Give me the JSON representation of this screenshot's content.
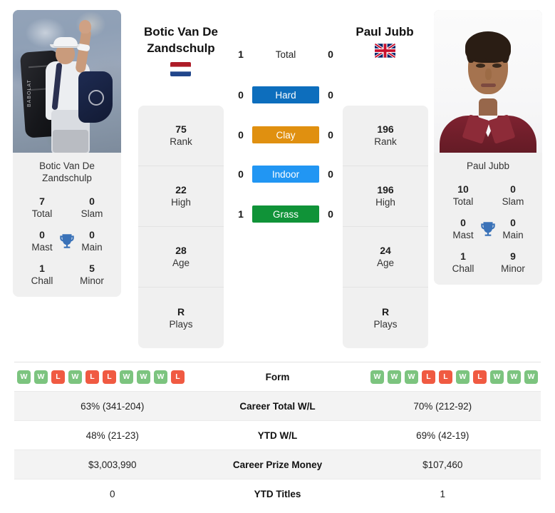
{
  "players": {
    "left": {
      "name": "Botic Van De Zandschulp",
      "name_line1": "Botic Van De",
      "name_line2": "Zandschulp",
      "card_name": "Botic Van De Zandschulp",
      "flag": "netherlands-flag",
      "titles": [
        {
          "value": "7",
          "label": "Total"
        },
        {
          "value": "0",
          "label": "Slam"
        },
        {
          "value": "0",
          "label": "Mast"
        },
        {
          "value": "0",
          "label": "Main"
        },
        {
          "value": "1",
          "label": "Chall"
        },
        {
          "value": "5",
          "label": "Minor"
        }
      ],
      "stats": [
        {
          "value": "75",
          "label": "Rank"
        },
        {
          "value": "22",
          "label": "High"
        },
        {
          "value": "28",
          "label": "Age"
        },
        {
          "value": "R",
          "label": "Plays"
        }
      ],
      "h2h": {
        "total": "1",
        "hard": "0",
        "clay": "0",
        "indoor": "0",
        "grass": "1"
      },
      "form": [
        "W",
        "W",
        "L",
        "W",
        "L",
        "L",
        "W",
        "W",
        "W",
        "L"
      ],
      "career_wl": "63% (341-204)",
      "ytd_wl": "48% (21-23)",
      "career_prize_money": "$3,003,990",
      "ytd_titles": "0"
    },
    "right": {
      "name": "Paul Jubb",
      "name_line1": "Paul Jubb",
      "name_line2": "",
      "card_name": "Paul Jubb",
      "flag": "great-britain-flag",
      "titles": [
        {
          "value": "10",
          "label": "Total"
        },
        {
          "value": "0",
          "label": "Slam"
        },
        {
          "value": "0",
          "label": "Mast"
        },
        {
          "value": "0",
          "label": "Main"
        },
        {
          "value": "1",
          "label": "Chall"
        },
        {
          "value": "9",
          "label": "Minor"
        }
      ],
      "stats": [
        {
          "value": "196",
          "label": "Rank"
        },
        {
          "value": "196",
          "label": "High"
        },
        {
          "value": "24",
          "label": "Age"
        },
        {
          "value": "R",
          "label": "Plays"
        }
      ],
      "h2h": {
        "total": "0",
        "hard": "0",
        "clay": "0",
        "indoor": "0",
        "grass": "0"
      },
      "form": [
        "W",
        "W",
        "W",
        "L",
        "L",
        "W",
        "L",
        "W",
        "W",
        "W"
      ],
      "career_wl": "70% (212-92)",
      "ytd_wl": "69% (42-19)",
      "career_prize_money": "$107,460",
      "ytd_titles": "1"
    }
  },
  "h2h_rows": [
    {
      "key": "total",
      "label": "Total",
      "color": "",
      "plain": true
    },
    {
      "key": "hard",
      "label": "Hard",
      "color": "#0d6ebd",
      "plain": false
    },
    {
      "key": "clay",
      "label": "Clay",
      "color": "#e09010",
      "plain": false
    },
    {
      "key": "indoor",
      "label": "Indoor",
      "color": "#2196f3",
      "plain": false
    },
    {
      "key": "grass",
      "label": "Grass",
      "color": "#109338",
      "plain": false
    }
  ],
  "comparison_rows": [
    {
      "label": "Form",
      "type": "form",
      "left": "form",
      "right": "form"
    },
    {
      "label": "Career Total W/L",
      "type": "text",
      "left": "63% (341-204)",
      "right": "70% (212-92)"
    },
    {
      "label": "YTD W/L",
      "type": "text",
      "left": "48% (21-23)",
      "right": "69% (42-19)"
    },
    {
      "label": "Career Prize Money",
      "type": "text",
      "left": "$3,003,990",
      "right": "$107,460"
    },
    {
      "label": "YTD Titles",
      "type": "text",
      "left": "0",
      "right": "1"
    }
  ],
  "colors": {
    "hard": "#0d6ebd",
    "clay": "#e09010",
    "indoor": "#2196f3",
    "grass": "#109338",
    "win_badge": "#7cc47f",
    "loss_badge": "#f05a42",
    "card_bg": "#f0f0f0",
    "trophy": "#3a72b8"
  },
  "labels": {
    "trophy_icon": "trophy-icon"
  }
}
